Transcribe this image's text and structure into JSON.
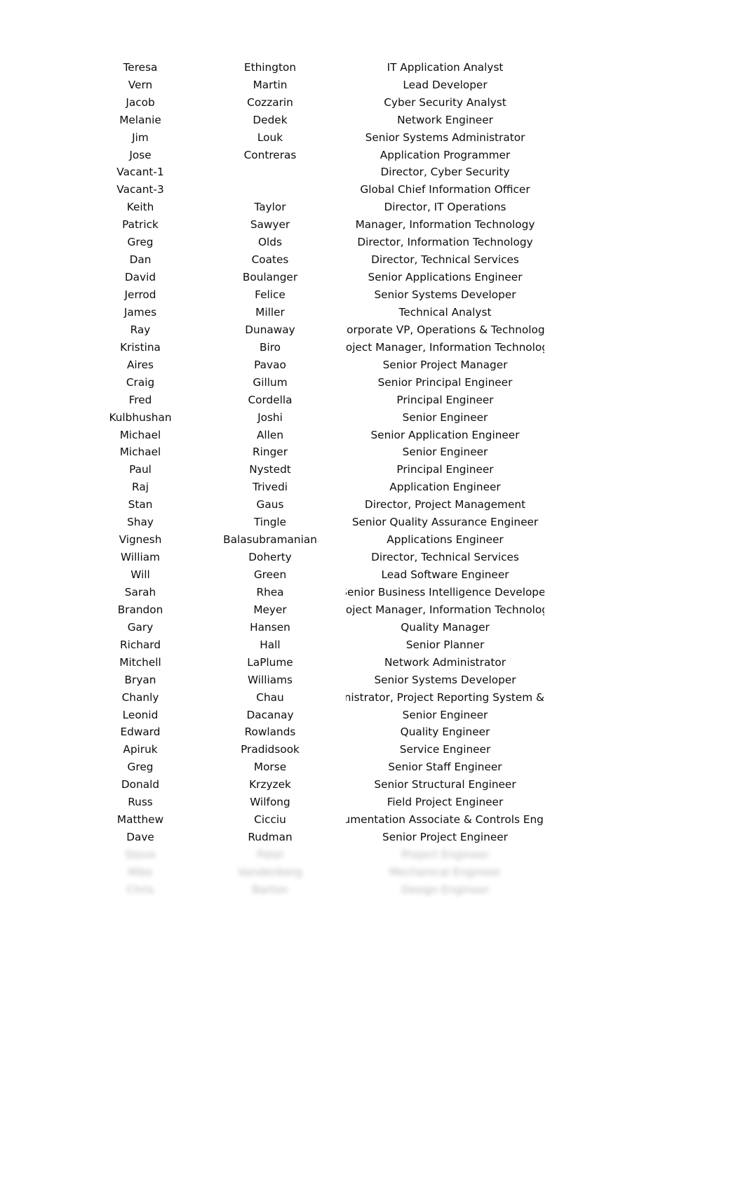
{
  "document": {
    "kind": "spreadsheet-roster",
    "columns": [
      "First Name",
      "Last Name",
      "Job Title"
    ],
    "background_color": "#ffffff",
    "text_color": "#0d0d0d"
  },
  "rows": [
    {
      "first": "Teresa",
      "last": "Ethington",
      "title": "IT Application Analyst",
      "redacted": false
    },
    {
      "first": "Vern",
      "last": "Martin",
      "title": "Lead Developer",
      "redacted": false
    },
    {
      "first": "Jacob",
      "last": "Cozzarin",
      "title": "Cyber Security Analyst",
      "redacted": false
    },
    {
      "first": "Melanie",
      "last": "Dedek",
      "title": "Network Engineer",
      "redacted": false
    },
    {
      "first": "Jim",
      "last": "Louk",
      "title": "Senior Systems Administrator",
      "redacted": false
    },
    {
      "first": "Jose",
      "last": "Contreras",
      "title": "Application Programmer",
      "redacted": false
    },
    {
      "first": "Vacant-1",
      "last": "",
      "title": "Director, Cyber Security",
      "redacted": false
    },
    {
      "first": "Vacant-3",
      "last": "",
      "title": "Global Chief Information Officer",
      "redacted": false
    },
    {
      "first": "Keith",
      "last": "Taylor",
      "title": "Director, IT Operations",
      "redacted": false
    },
    {
      "first": "Patrick",
      "last": "Sawyer",
      "title": "Manager, Information Technology",
      "redacted": false
    },
    {
      "first": "Greg",
      "last": "Olds",
      "title": "Director, Information Technology",
      "redacted": false
    },
    {
      "first": "Dan",
      "last": "Coates",
      "title": "Director, Technical Services",
      "redacted": false
    },
    {
      "first": "David",
      "last": "Boulanger",
      "title": "Senior Applications Engineer",
      "redacted": false
    },
    {
      "first": "Jerrod",
      "last": "Felice",
      "title": "Senior Systems Developer",
      "redacted": false
    },
    {
      "first": "James",
      "last": "Miller",
      "title": "Technical Analyst",
      "redacted": false
    },
    {
      "first": "Ray",
      "last": "Dunaway",
      "title": "Corporate VP, Operations & Technology",
      "redacted": false
    },
    {
      "first": "Kristina",
      "last": "Biro",
      "title": "Project Manager, Information Technology",
      "redacted": false
    },
    {
      "first": "Aires",
      "last": "Pavao",
      "title": "Senior Project Manager",
      "redacted": false
    },
    {
      "first": "Craig",
      "last": "Gillum",
      "title": "Senior Principal Engineer",
      "redacted": false
    },
    {
      "first": "Fred",
      "last": "Cordella",
      "title": "Principal Engineer",
      "redacted": false
    },
    {
      "first": "Kulbhushan",
      "last": "Joshi",
      "title": "Senior Engineer",
      "redacted": false
    },
    {
      "first": "Michael",
      "last": "Allen",
      "title": "Senior Application Engineer",
      "redacted": false
    },
    {
      "first": "Michael",
      "last": "Ringer",
      "title": "Senior Engineer",
      "redacted": false
    },
    {
      "first": "Paul",
      "last": "Nystedt",
      "title": "Principal Engineer",
      "redacted": false
    },
    {
      "first": "Raj",
      "last": "Trivedi",
      "title": "Application Engineer",
      "redacted": false
    },
    {
      "first": "Stan",
      "last": "Gaus",
      "title": "Director, Project Management",
      "redacted": false
    },
    {
      "first": "Shay",
      "last": "Tingle",
      "title": "Senior Quality Assurance Engineer",
      "redacted": false
    },
    {
      "first": "Vignesh",
      "last": "Balasubramanian",
      "title": "Applications Engineer",
      "redacted": false
    },
    {
      "first": "William",
      "last": "Doherty",
      "title": "Director, Technical Services",
      "redacted": false
    },
    {
      "first": "Will",
      "last": "Green",
      "title": "Lead Software Engineer",
      "redacted": false
    },
    {
      "first": "Sarah",
      "last": "Rhea",
      "title": "Senior Business Intelligence Developer",
      "redacted": false
    },
    {
      "first": "Brandon",
      "last": "Meyer",
      "title": "Project Manager, Information Technology",
      "redacted": false
    },
    {
      "first": "Gary",
      "last": "Hansen",
      "title": "Quality Manager",
      "redacted": false
    },
    {
      "first": "Richard",
      "last": "Hall",
      "title": "Senior Planner",
      "redacted": false
    },
    {
      "first": "Mitchell",
      "last": "LaPlume",
      "title": "Network Administrator",
      "redacted": false
    },
    {
      "first": "Bryan",
      "last": "Williams",
      "title": "Senior Systems Developer",
      "redacted": false
    },
    {
      "first": "Chanly",
      "last": "Chau",
      "title": "Administrator, Project Reporting System & Data",
      "redacted": false
    },
    {
      "first": "Leonid",
      "last": "Dacanay",
      "title": "Senior Engineer",
      "redacted": false
    },
    {
      "first": "Edward",
      "last": "Rowlands",
      "title": "Quality Engineer",
      "redacted": false
    },
    {
      "first": "Apiruk",
      "last": "Pradidsook",
      "title": "Service Engineer",
      "redacted": false
    },
    {
      "first": "Greg",
      "last": "Morse",
      "title": "Senior Staff Engineer",
      "redacted": false
    },
    {
      "first": "Donald",
      "last": "Krzyzek",
      "title": "Senior Structural Engineer",
      "redacted": false
    },
    {
      "first": "Russ",
      "last": "Wilfong",
      "title": "Field Project Engineer",
      "redacted": false
    },
    {
      "first": "Matthew",
      "last": "Cicciu",
      "title": "Instrumentation Associate & Controls Engineer",
      "redacted": false
    },
    {
      "first": "Dave",
      "last": "Rudman",
      "title": "Senior Project Engineer",
      "redacted": false
    },
    {
      "first": "Steve",
      "last": "Patel",
      "title": "Project Engineer",
      "redacted": true
    },
    {
      "first": "Mike",
      "last": "Vandenberg",
      "title": "Mechanical Engineer",
      "redacted": true
    },
    {
      "first": "Chris",
      "last": "Barton",
      "title": "Design Engineer",
      "redacted": true
    }
  ]
}
